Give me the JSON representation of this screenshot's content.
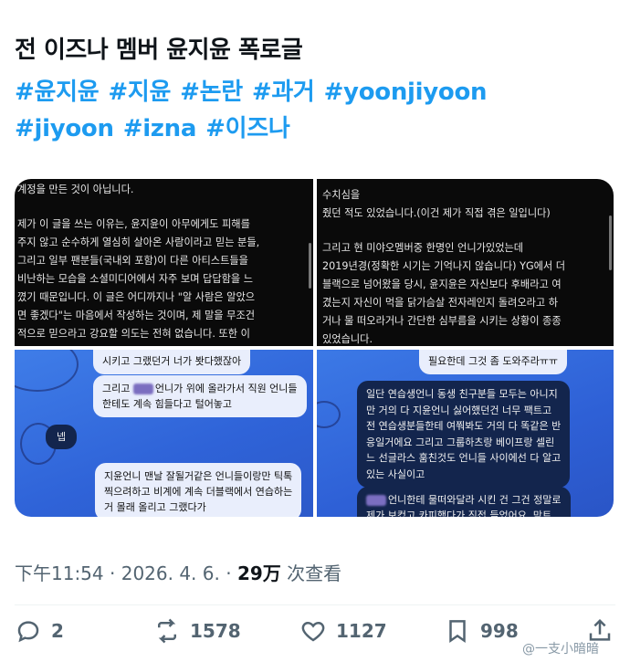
{
  "post": {
    "title": "전 이즈나 멤버 윤지윤 폭로글",
    "hashtags_row1": [
      "#윤지윤",
      "#지윤",
      "#논란",
      "#과거",
      "#yoonjiyoon"
    ],
    "hashtags_row2": [
      "#jiyoon",
      "#izna",
      "#이즈나"
    ]
  },
  "images": {
    "top_left_lines": [
      "계정을 만든 것이 아닙니다.",
      "",
      "제가 이 글을 쓰는 이유는, 윤지윤이 아무에게도 피해를",
      "주지 않고 순수하게 열심히 살아온 사람이라고 믿는 분들,",
      "그리고 일부 팬분들(국내외 포함)이 다른 아티스트들을",
      "비난하는 모습을 소셜미디어에서 자주 보며 답답함을 느",
      "꼈기 때문입니다. 이 글은 어디까지나 \"알 사람은 알았으",
      "면 좋겠다\"는 마음에서 작성하는 것이며, 제 말을 무조건",
      "적으로 믿으라고 강요할 의도는 전혀 없습니다. 또한 이"
    ],
    "top_right_lines": [
      "수치심을",
      "줬던 적도 있었습니다.(이건 제가 직접 겪은 일입니다)",
      "",
      "그리고 현 미야오멤버중 한명인 언니가있었는데",
      "2019년경(정확한 시기는 기억나지 않습니다) YG에서 더",
      "블랙으로 넘어왔을 당시, 윤지윤은 자신보다 후배라고 여",
      "겼는지 자신이 먹을 닭가슴살 전자레인지 돌려오라고 하",
      "거나 물 떠오라거나 간단한 심부름을 시키는 상황이 종종",
      "있었습니다."
    ],
    "bl_bubble1": "시키고 그랬던거 너가 봣다했잖아",
    "bl_bubble2_a": "그리고",
    "bl_bubble2_b": "언니가 위에 올라가서 직원 언니들",
    "bl_bubble2_c": "한테도 계속 힘들다고 털어놓고",
    "bl_reply": "넵",
    "bl_bubble3": [
      "지윤언니 맨날 잘될거같은 언니들이랑만 틱톡",
      "찍으려하고 비계에 계속 더블랙에서 연습하는",
      "거 몰래 올리고 그랬다가"
    ],
    "br_bubble1": "필요한데 그것 좀 도와주라ㅠㅠ",
    "br_bubble2": [
      "일단 연습생언니 동생 친구분들 모두는 아니지",
      "만 거의 다 지윤언니 싫어했던건 너무 팩트고",
      "전 연습생분들한테 여쭤봐도 거의 다 똑같은 반",
      "응일거에요 그리고 그룹하츠랑 베이프랑 셀린",
      "느 선글라스 훔친것도 언니들 사이에선 다 알고",
      "있는 사실이고"
    ],
    "br_bubble3_a": "언니한테 물떠와달라 시킨 건 그건 정말로",
    "br_bubble3_b": "제가 보컸고 카피했다가 직접 들었어요. 막트"
  },
  "meta": {
    "time": "下午11:54",
    "sep1": " · ",
    "date": "2026. 4. 6.",
    "sep2": " · ",
    "views": "29万",
    "views_label": " 次查看"
  },
  "actions": {
    "replies": "2",
    "reposts": "1578",
    "likes": "1127",
    "bookmarks": "998"
  },
  "watermark": "@一支小暗暗",
  "colors": {
    "hashtag": "#1d9bf0",
    "text": "#0f1419",
    "muted": "#536471"
  },
  "icons": [
    "reply-icon",
    "repost-icon",
    "like-icon",
    "bookmark-icon",
    "share-icon"
  ]
}
